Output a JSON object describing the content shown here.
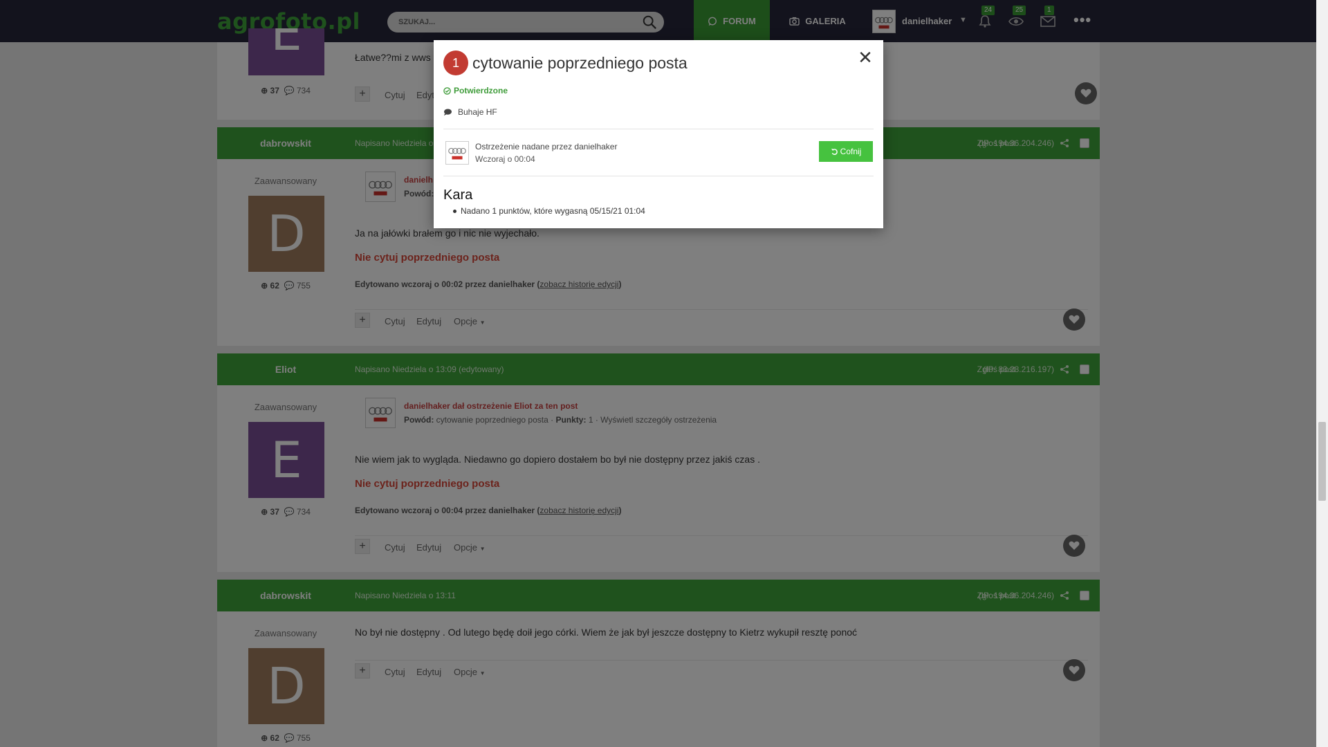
{
  "topbar": {
    "logo": "agrofoto.pl",
    "search_placeholder": "SZUKAJ...",
    "nav_forum": "FORUM",
    "nav_galeria": "GALERIA",
    "username": "danielhaker",
    "notifications_count": "24",
    "watched_count": "25",
    "messages_count": "1"
  },
  "brand_colors": {
    "dark": "#27263a",
    "green": "#3fa53a",
    "red": "#d84638"
  },
  "posts": [
    {
      "text": "Łatwe??mi z wws",
      "stats_rep": "37",
      "stats_posts": "734",
      "action_quote": "Cytuj",
      "action_edit": "Edyt"
    },
    {
      "author": "dabrowskit",
      "date": "Napisano Niedziela o",
      "report": "Zgłoś post",
      "ip": "(IP: 194.36.204.246)",
      "rank": "Zaawansowany",
      "avatar_letter": "D",
      "warn_title": "danielh",
      "warn_reason_label": "Powód:",
      "text": "Ja na jałówki brałem go i nic nie wyjechało.",
      "nocite": "Nie cytuj poprzedniego posta",
      "edited_prefix": "Edytowano wczoraj o 00:02 przez danielhaker (",
      "edited_link": "zobacz historię edycji",
      "edited_suffix": ")",
      "stats_rep": "62",
      "stats_posts": "755",
      "action_quote": "Cytuj",
      "action_edit": "Edytuj",
      "action_options": "Opcje"
    },
    {
      "author": "Eliot",
      "date": "Napisano Niedziela o 13:09 (edytowany)",
      "report": "Zgłoś post",
      "ip": "(IP: 83.28.216.197)",
      "rank": "Zaawansowany",
      "avatar_letter": "E",
      "warn_title": "danielhaker dał ostrzeżenie Eliot za ten post",
      "warn_reason_label": "Powód:",
      "warn_reason": "cytowanie poprzedniego posta · ",
      "warn_points_label": "Punkty:",
      "warn_points": "1 · Wyświetl szczegóły ostrzeżenia",
      "text": "Nie wiem jak to wygląda. Niedawno go  dopiero dostałem bo był nie dostępny przez jakiś czas .",
      "nocite": "Nie cytuj poprzedniego posta",
      "edited_prefix": "Edytowano wczoraj o 00:04 przez danielhaker (",
      "edited_link": "zobacz historię edycji",
      "edited_suffix": ")",
      "stats_rep": "37",
      "stats_posts": "734",
      "action_quote": "Cytuj",
      "action_edit": "Edytuj",
      "action_options": "Opcje"
    },
    {
      "author": "dabrowskit",
      "date": "Napisano Niedziela o 13:11",
      "report": "Zgłoś post",
      "ip": "(IP: 194.36.204.246)",
      "rank": "Zaawansowany",
      "avatar_letter": "D",
      "text": "No był nie dostępny . Od lutego będę doił jego córki. Wiem że jak był jeszcze dostępny to Kietrz wykupił resztę ponoć",
      "stats_rep": "62",
      "stats_posts": "755",
      "action_quote": "Cytuj",
      "action_edit": "Edytuj",
      "action_options": "Opcje"
    }
  ],
  "modal": {
    "number": "1",
    "title": "cytowanie poprzedniego posta",
    "status": "Potwierdzone",
    "topic": "Buhaje HF",
    "issued_by": "Ostrzeżenie nadane przez danielhaker",
    "when": "Wczoraj o 00:04",
    "undo": "Cofnij",
    "kara_title": "Kara",
    "penalty": "Nadano 1 punktów, które wygasną 05/15/21 01:04"
  }
}
